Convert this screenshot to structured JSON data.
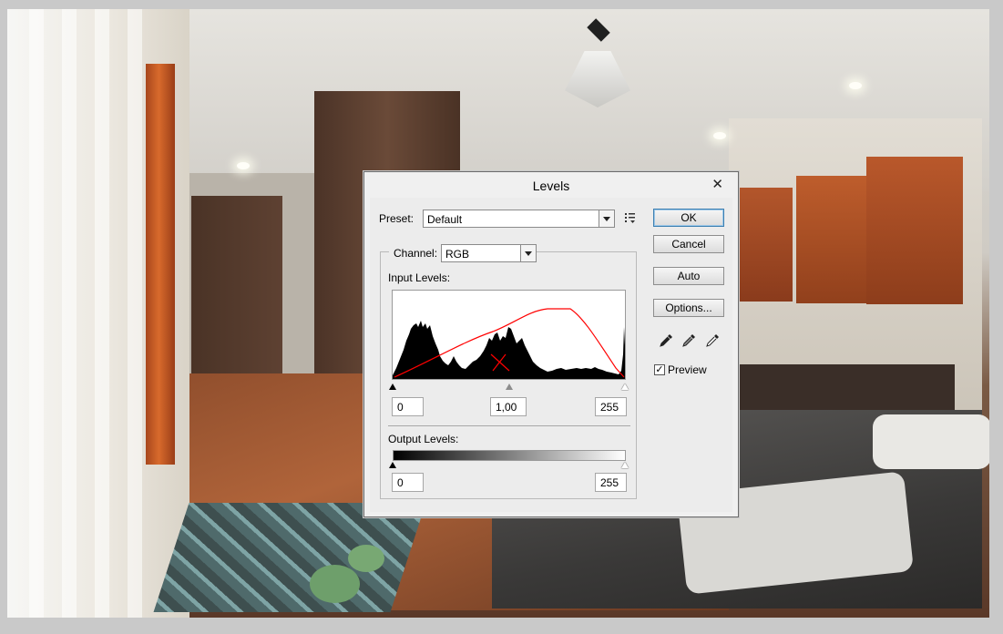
{
  "dialog": {
    "title": "Levels",
    "close_glyph": "✕",
    "preset_label": "Preset:",
    "preset_value": "Default",
    "channel_label": "Channel:",
    "channel_value": "RGB",
    "input_levels_label": "Input Levels:",
    "input_black": "0",
    "input_gamma": "1,00",
    "input_white": "255",
    "output_levels_label": "Output Levels:",
    "output_black": "0",
    "output_white": "255",
    "buttons": {
      "ok": "OK",
      "cancel": "Cancel",
      "auto": "Auto",
      "options": "Options..."
    },
    "preview_label": "Preview",
    "preview_checked": true,
    "icons": [
      "preset-menu-icon",
      "black-eyedropper-icon",
      "gray-eyedropper-icon",
      "white-eyedropper-icon",
      "close-icon"
    ]
  },
  "colors": {
    "annotation_curve": "#ff0000",
    "ok_focus": "#3c7fb1"
  }
}
